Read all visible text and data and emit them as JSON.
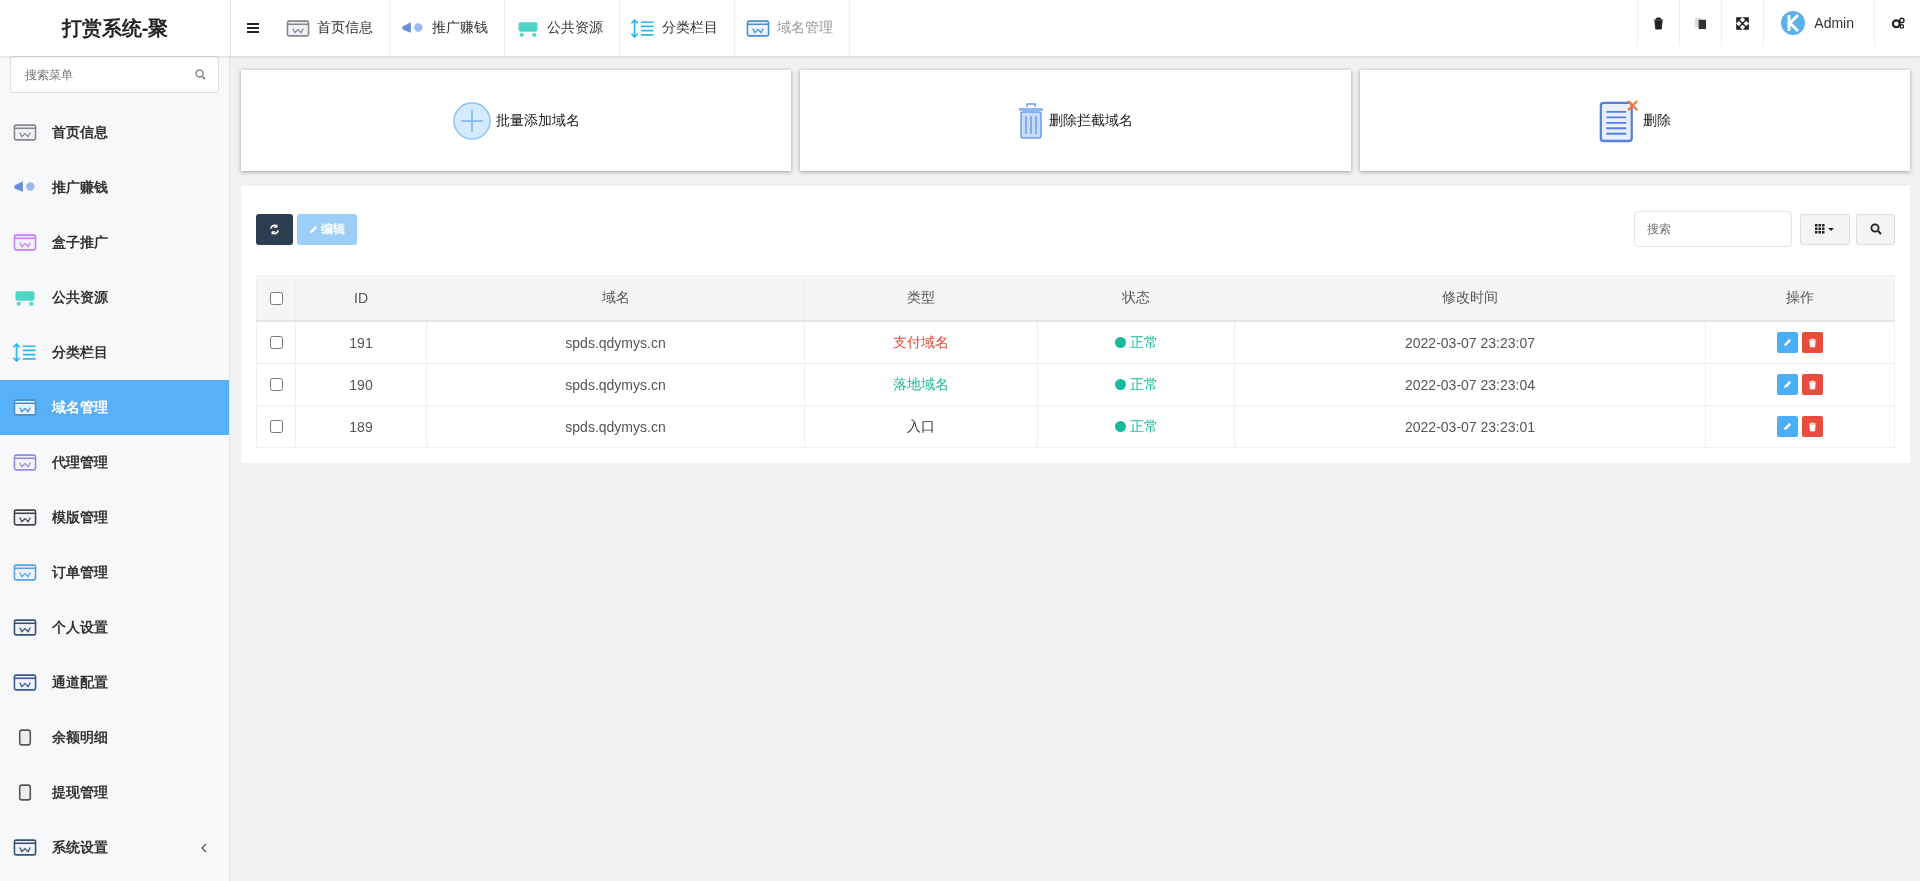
{
  "brand": "打赏系统-聚",
  "top_tabs": [
    {
      "label": "首页信息",
      "selected": false
    },
    {
      "label": "推广赚钱",
      "selected": false
    },
    {
      "label": "公共资源",
      "selected": false
    },
    {
      "label": "分类栏目",
      "selected": false
    },
    {
      "label": "域名管理",
      "selected": true
    }
  ],
  "user": {
    "name": "Admin"
  },
  "sidebar": {
    "search": {
      "placeholder": "搜索菜单"
    },
    "items": [
      {
        "label": "首页信息",
        "selected": false
      },
      {
        "label": "推广赚钱",
        "selected": false
      },
      {
        "label": "盒子推广",
        "selected": false
      },
      {
        "label": "公共资源",
        "selected": false
      },
      {
        "label": "分类栏目",
        "selected": false
      },
      {
        "label": "域名管理",
        "selected": true
      },
      {
        "label": "代理管理",
        "selected": false
      },
      {
        "label": "模版管理",
        "selected": false
      },
      {
        "label": "订单管理",
        "selected": false
      },
      {
        "label": "个人设置",
        "selected": false
      },
      {
        "label": "通道配置",
        "selected": false
      },
      {
        "label": "余额明细",
        "selected": false
      },
      {
        "label": "提现管理",
        "selected": false
      },
      {
        "label": "系统设置",
        "selected": false,
        "expandable": true
      }
    ]
  },
  "actions": [
    {
      "label": "批量添加域名",
      "kind": "add"
    },
    {
      "label": "删除拦截域名",
      "kind": "trash"
    },
    {
      "label": "删除",
      "kind": "doc"
    }
  ],
  "toolbar": {
    "edit": {
      "label": "编辑",
      "disabled": true
    },
    "search": {
      "placeholder": "搜索"
    }
  },
  "table": {
    "all_checked": false,
    "columns": [
      "ID",
      "域名",
      "类型",
      "状态",
      "修改时间",
      "操作"
    ],
    "rows": [
      {
        "checked": false,
        "id": "191",
        "domain": "spds.qdymys.cn",
        "type": {
          "label": "支付域名",
          "kind": "pay"
        },
        "status": {
          "label": "正常",
          "color": "#18bc9c"
        },
        "time": "2022-03-07 23:23:07"
      },
      {
        "checked": false,
        "id": "190",
        "domain": "spds.qdymys.cn",
        "type": {
          "label": "落地域名",
          "kind": "landing"
        },
        "status": {
          "label": "正常",
          "color": "#18bc9c"
        },
        "time": "2022-03-07 23:23:04"
      },
      {
        "checked": false,
        "id": "189",
        "domain": "spds.qdymys.cn",
        "type": {
          "label": "入口",
          "kind": "entry"
        },
        "status": {
          "label": "正常",
          "color": "#18bc9c"
        },
        "time": "2022-03-07 23:23:01"
      }
    ]
  }
}
